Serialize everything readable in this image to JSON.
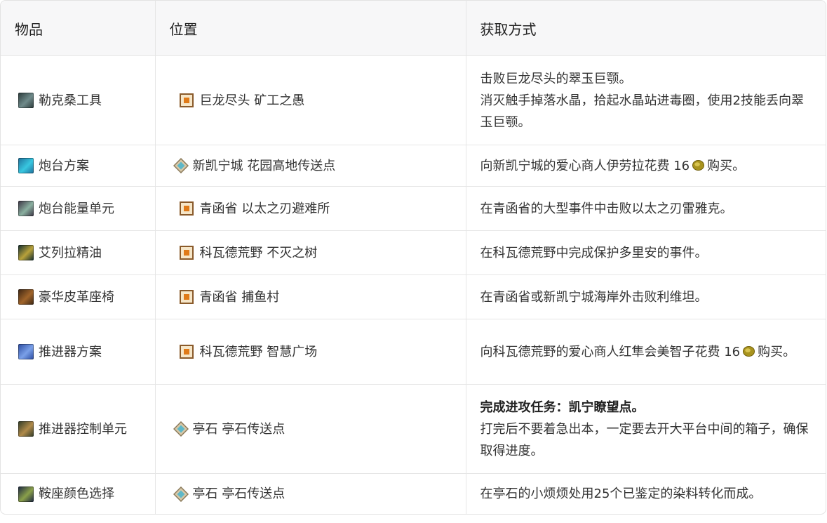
{
  "headers": {
    "item": "物品",
    "location": "位置",
    "method": "获取方式"
  },
  "rows": [
    {
      "item": "勒克桑工具",
      "icon_colors": [
        "#2a3a3a",
        "#6f8a8a"
      ],
      "location_type": "poi",
      "location": "巨龙尽头 矿工之愚",
      "method_lines": [
        "击败巨龙尽头的翠玉巨颚。",
        "消灭触手掉落水晶，拾起水晶站进毒圈，使用2技能丢向翠玉巨颚。"
      ]
    },
    {
      "item": "炮台方案",
      "icon_colors": [
        "#1d6e9a",
        "#38c7e0"
      ],
      "location_type": "waypoint",
      "location": "新凯宁城 花园高地传送点",
      "method_before": "向新凯宁城的爱心商人伊劳拉花费 16",
      "method_after": "购买。"
    },
    {
      "item": "炮台能量单元",
      "icon_colors": [
        "#3a3242",
        "#8ab0a0"
      ],
      "location_type": "poi",
      "location": "青函省 以太之刃避难所",
      "method": "在青函省的大型事件中击败以太之刃雷雅克。"
    },
    {
      "item": "艾列拉精油",
      "icon_colors": [
        "#0f2a2e",
        "#b8a23a"
      ],
      "location_type": "poi",
      "location": "科瓦德荒野 不灭之树",
      "method": "在科瓦德荒野中完成保护多里安的事件。"
    },
    {
      "item": "豪华皮革座椅",
      "icon_colors": [
        "#3a2412",
        "#a0642a"
      ],
      "location_type": "poi",
      "location": "青函省 捕鱼村",
      "method": "在青函省或新凯宁城海岸外击败利维坦。"
    },
    {
      "item": "推进器方案",
      "icon_colors": [
        "#2a4aa0",
        "#7aa0e8"
      ],
      "location_type": "poi",
      "location": "科瓦德荒野 智慧广场",
      "method_before": "向科瓦德荒野的爱心商人红隼会美智子花费 16",
      "method_after": "购买。"
    },
    {
      "item": "推进器控制单元",
      "icon_colors": [
        "#2e3a26",
        "#b08a4a"
      ],
      "location_type": "waypoint",
      "location": "亭石 亭石传送点",
      "method_bold": "完成进攻任务：凯宁瞭望点。",
      "method_lines": [
        "打完后不要着急出本，一定要去开大平台中间的箱子，确保取得进度。"
      ]
    },
    {
      "item": "鞍座颜色选择",
      "icon_colors": [
        "#1a2440",
        "#8aa04a"
      ],
      "location_type": "waypoint",
      "location": "亭石 亭石传送点",
      "method": "在亭石的小烦烦处用25个已鉴定的染料转化而成。"
    }
  ]
}
